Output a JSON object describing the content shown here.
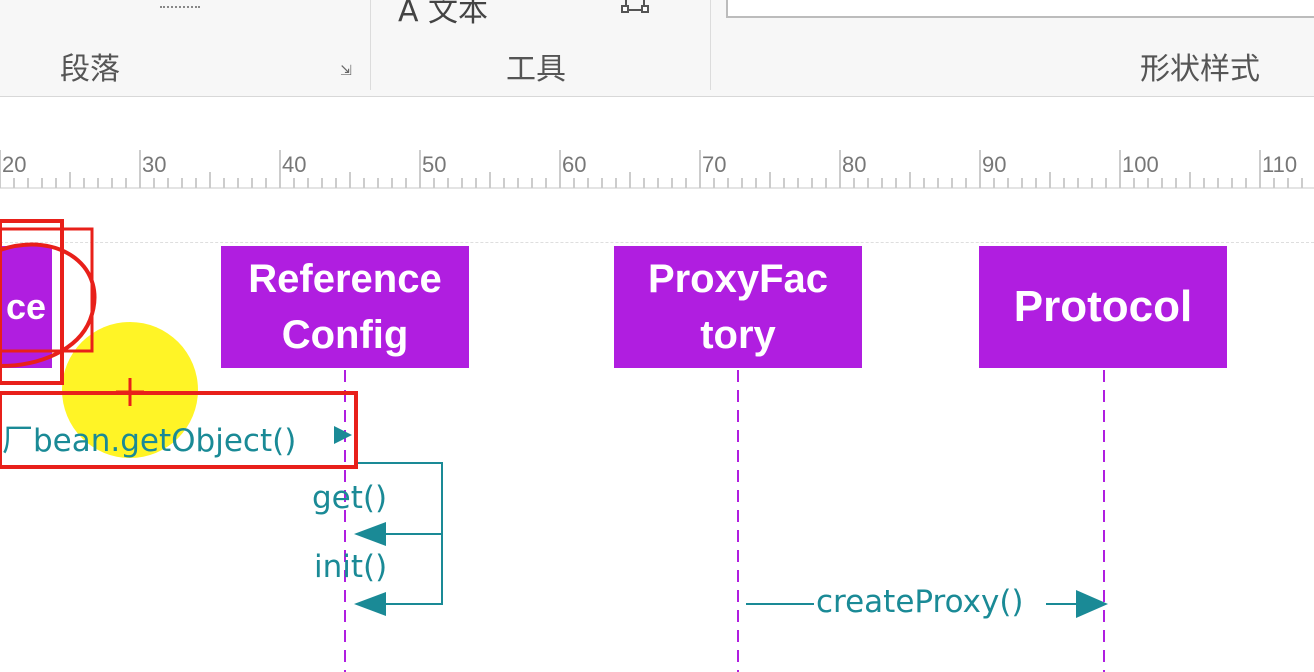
{
  "ribbon": {
    "groups": {
      "paragraph": "段落",
      "tools": "工具",
      "shape_styles": "形状样式"
    },
    "partial_text": "A 文本"
  },
  "ruler": {
    "labels": [
      "20",
      "30",
      "40",
      "50",
      "60",
      "70",
      "80",
      "90",
      "100",
      "110"
    ]
  },
  "diagram": {
    "lifelines": {
      "partial": "ce",
      "reference_config": [
        "Reference",
        "Config"
      ],
      "proxy_factory": [
        "ProxyFac",
        "tory"
      ],
      "protocol": "Protocol"
    },
    "messages": {
      "get_object": "厂bean.getObject()",
      "get": "get()",
      "init": "init()",
      "create_proxy": "createProxy()"
    },
    "colors": {
      "lifeline_fill": "#b01ee0",
      "message": "#1a8a96",
      "annotation_red": "#e8201a",
      "highlight": "#fff200"
    }
  }
}
